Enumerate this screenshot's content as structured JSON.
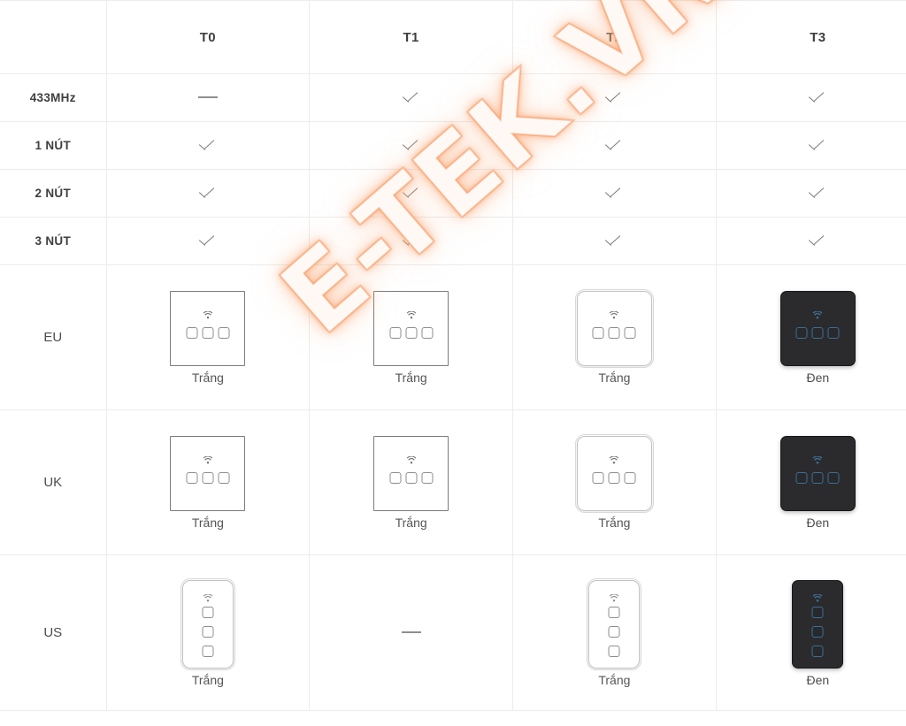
{
  "watermark": {
    "text": "E-TEK.VN",
    "color": "#f8965c"
  },
  "table": {
    "corner_label": "",
    "columns": [
      "T0",
      "T1",
      "T2",
      "T3"
    ],
    "feature_rows": [
      {
        "label": "433MHz",
        "cells": [
          "dash",
          "check",
          "check",
          "check"
        ]
      },
      {
        "label": "1 NÚT",
        "cells": [
          "check",
          "check",
          "check",
          "check"
        ]
      },
      {
        "label": "2 NÚT",
        "cells": [
          "check",
          "check",
          "check",
          "check"
        ]
      },
      {
        "label": "3 NÚT",
        "cells": [
          "check",
          "check",
          "check",
          "check"
        ]
      }
    ],
    "product_rows": [
      {
        "label": "EU",
        "cells": [
          {
            "type": "switch",
            "style": "flat",
            "shape": "square",
            "buttons": 3,
            "caption": "Trắng"
          },
          {
            "type": "switch",
            "style": "flat",
            "shape": "square",
            "buttons": 3,
            "caption": "Trắng"
          },
          {
            "type": "switch",
            "style": "round",
            "shape": "square",
            "buttons": 3,
            "caption": "Trắng"
          },
          {
            "type": "switch",
            "style": "dark",
            "shape": "square",
            "buttons": 3,
            "caption": "Đen"
          }
        ]
      },
      {
        "label": "UK",
        "cells": [
          {
            "type": "switch",
            "style": "flat",
            "shape": "square",
            "buttons": 3,
            "caption": "Trắng"
          },
          {
            "type": "switch",
            "style": "flat",
            "shape": "square",
            "buttons": 3,
            "caption": "Trắng"
          },
          {
            "type": "switch",
            "style": "round",
            "shape": "square",
            "buttons": 3,
            "caption": "Trắng"
          },
          {
            "type": "switch",
            "style": "dark",
            "shape": "square",
            "buttons": 3,
            "caption": "Đen"
          }
        ]
      },
      {
        "label": "US",
        "cells": [
          {
            "type": "switch",
            "style": "round",
            "shape": "vertical",
            "buttons": 3,
            "caption": "Trắng"
          },
          {
            "type": "dash"
          },
          {
            "type": "switch",
            "style": "round",
            "shape": "vertical",
            "buttons": 3,
            "caption": "Trắng"
          },
          {
            "type": "switch",
            "style": "dark",
            "shape": "vertical",
            "buttons": 3,
            "caption": "Đen"
          }
        ]
      }
    ]
  },
  "icons": {
    "check": "check-icon",
    "dash": "dash-icon",
    "wifi": "wifi-icon"
  }
}
